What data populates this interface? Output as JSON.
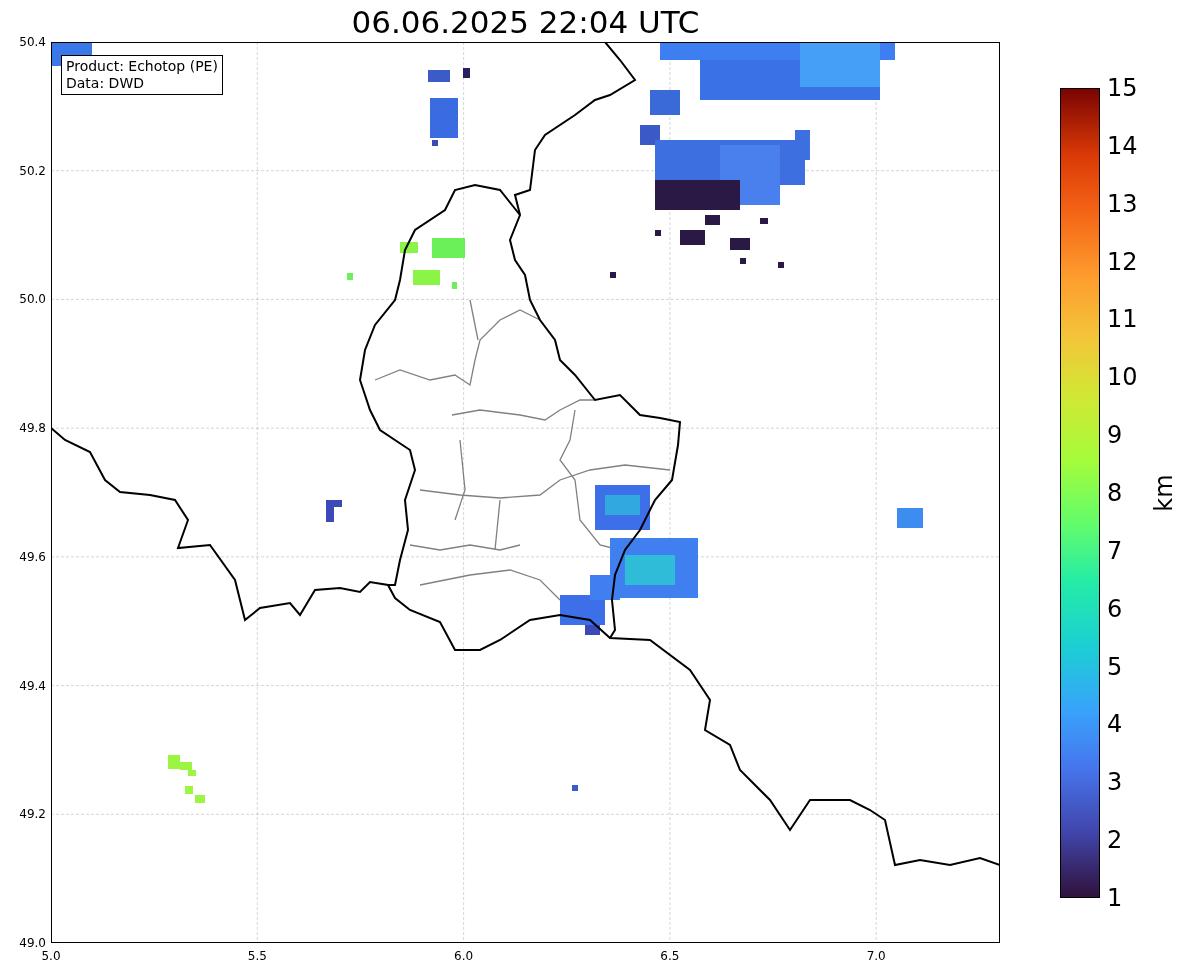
{
  "title": "06.06.2025 22:04 UTC",
  "info_box": {
    "lines": [
      "Product: Echotop (PE)",
      "Data: DWD"
    ]
  },
  "map": {
    "x_ticks": [
      "5.0",
      "5.5",
      "6.0",
      "6.5",
      "7.0"
    ],
    "y_ticks": [
      "50.4",
      "50.2",
      "50.0",
      "49.8",
      "49.6",
      "49.4",
      "49.2",
      "49.0"
    ]
  },
  "colorbar": {
    "label": "km",
    "ticks": [
      "15",
      "14",
      "13",
      "12",
      "11",
      "10",
      "9",
      "8",
      "7",
      "6",
      "5",
      "4",
      "3",
      "2",
      "1"
    ]
  }
}
